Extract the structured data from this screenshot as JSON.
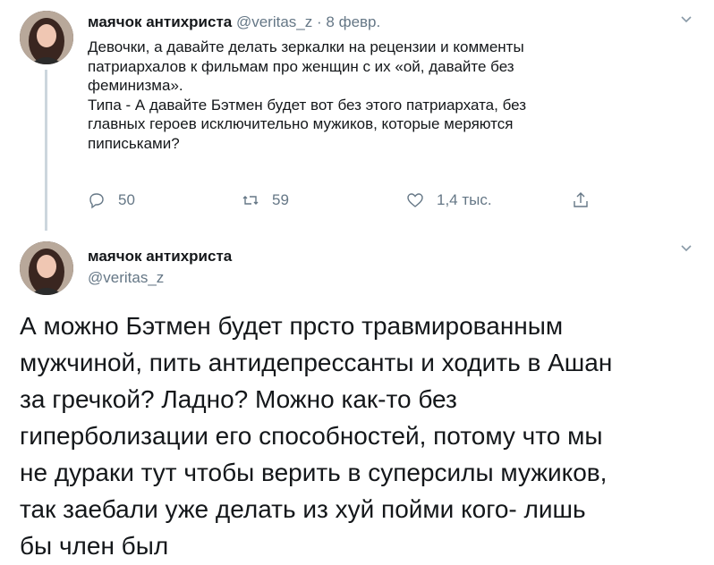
{
  "tweet1": {
    "name": "маячок антихриста",
    "handle": "@veritas_z",
    "separator": "·",
    "date": "8 февр.",
    "text": "Девочки, а давайте делать зеркалки на рецензии и комменты\nпатриархалов к фильмам про женщин с их «ой, давайте без\nфеминизма».\nТипа - А давайте Бэтмен будет вот без этого патриархата, без\nглавных героев исключительно мужиков, которые меряются\nпиписьками?",
    "replies": "50",
    "retweets": "59",
    "likes": "1,4 тыс."
  },
  "tweet2": {
    "name": "маячок антихриста",
    "handle": "@veritas_z",
    "text": "А можно Бэтмен будет прсто травмированным\nмужчиной, пить антидепрессанты и ходить в Ашан\nза гречкой? Ладно? Можно как-то без\nгиперболизации его способностей, потому что мы\nне дураки тут чтобы верить в суперсилы мужиков,\nтак заебали уже делать из хуй пойми кого- лишь\nбы член был"
  },
  "colors": {
    "text": "#14171a",
    "secondary": "#657786",
    "thread_line": "#ccd6dd",
    "divider": "#e6ecf0"
  },
  "icons": [
    "reply-icon",
    "retweet-icon",
    "like-icon",
    "share-icon",
    "chevron-down-icon"
  ]
}
